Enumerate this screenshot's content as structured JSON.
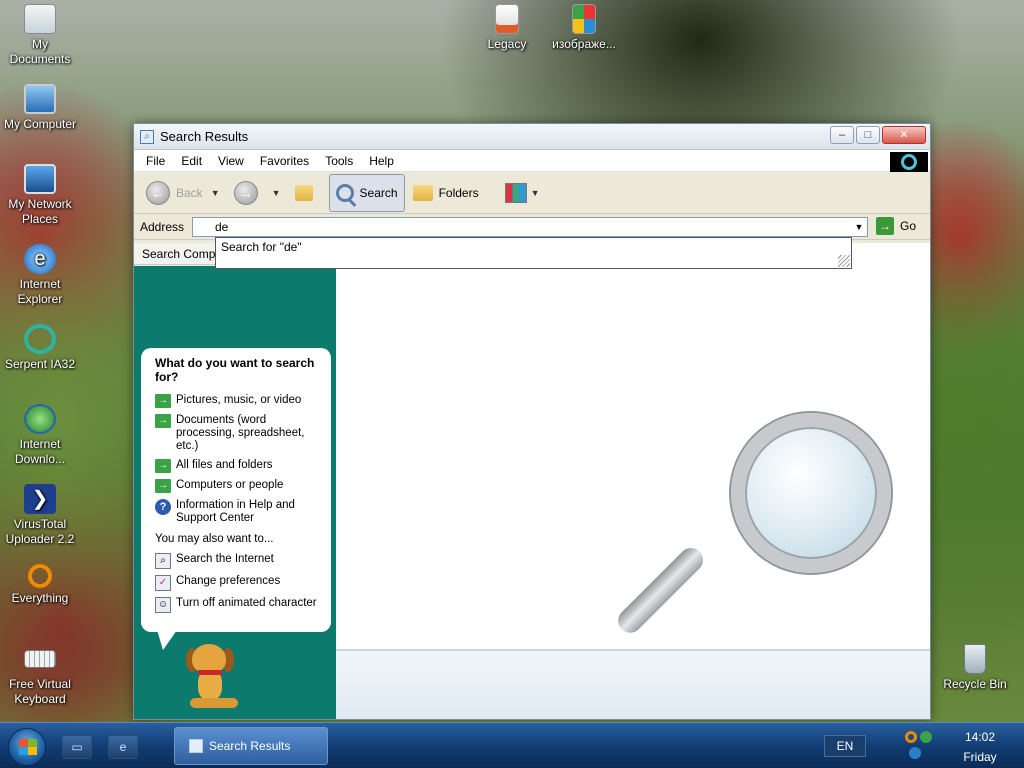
{
  "desktop": {
    "icons": [
      {
        "label": "My Documents"
      },
      {
        "label": "My Computer"
      },
      {
        "label": "My Network Places"
      },
      {
        "label": "Internet Explorer"
      },
      {
        "label": "Serpent IA32"
      },
      {
        "label": "Internet Downlo..."
      },
      {
        "label": "VirusTotal Uploader 2.2"
      },
      {
        "label": "Everything"
      },
      {
        "label": "Free Virtual Keyboard"
      },
      {
        "label": "Legacy"
      },
      {
        "label": "изображе..."
      },
      {
        "label": "Recycle Bin"
      }
    ]
  },
  "window": {
    "title": "Search Results",
    "controls": {
      "minimize": "–",
      "maximize": "□",
      "close": "✕"
    },
    "menu": [
      "File",
      "Edit",
      "View",
      "Favorites",
      "Tools",
      "Help"
    ],
    "toolbar": {
      "back": "Back",
      "search": "Search",
      "folders": "Folders"
    },
    "address": {
      "label": "Address",
      "value": "de",
      "go": "Go",
      "suggestion": "Search for \"de\""
    },
    "search_companion": "Search Comp",
    "assistant": {
      "question": "What do you want to search for?",
      "options": [
        "Pictures, music, or video",
        "Documents (word processing, spreadsheet, etc.)",
        "All files and folders",
        "Computers or people",
        "Information in Help and Support Center"
      ],
      "also_label": "You may also want to...",
      "also_options": [
        "Search the Internet",
        "Change preferences",
        "Turn off animated character"
      ]
    }
  },
  "taskbar": {
    "active_task": "Search Results",
    "language": "EN",
    "time": "14:02",
    "day": "Friday"
  },
  "colors": {
    "left_pane": "#0c7a6c",
    "taskbar": "#123e75",
    "go_arrow": "#3a9a3a"
  }
}
